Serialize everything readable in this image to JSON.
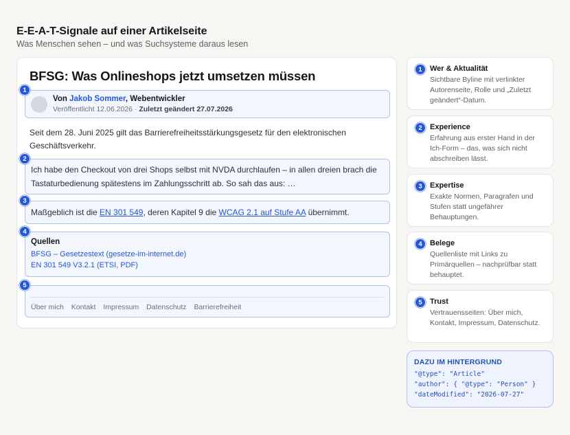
{
  "header": {
    "title": "E-E-A-T-Signale auf einer Artikelseite",
    "subtitle": "Was Menschen sehen – und was Suchsysteme daraus lesen"
  },
  "article": {
    "heading": "BFSG: Was Onlineshops jetzt umsetzen müssen",
    "byline": {
      "marker": "1",
      "prefix": "Von ",
      "author": "Jakob Sommer",
      "role": ", Webentwickler",
      "published": "Veröffentlicht 12.06.2026 · ",
      "updated": "Zuletzt geändert 27.07.2026"
    },
    "intro": "Seit dem 28. Juni 2025 gilt das Barrierefreiheitsstärkungsgesetz für den elektronischen Geschäftsverkehr.",
    "experience": {
      "marker": "2",
      "text": "Ich habe den Checkout von drei Shops selbst mit NVDA durchlaufen – in allen dreien brach die Tastaturbedienung spätestens im Zahlungsschritt ab. So sah das aus: …"
    },
    "expertise": {
      "marker": "3",
      "text_before": "Maßgeblich ist die ",
      "link1": "EN 301 549",
      "text_middle": ", deren Kapitel 9 die ",
      "link2": "WCAG 2.1 auf Stufe AA",
      "text_after": " übernimmt."
    },
    "sources": {
      "marker": "4",
      "title": "Quellen",
      "items": [
        "BFSG – Gesetzestext (gesetze-im-internet.de)",
        "EN 301 549 V3.2.1 (ETSI, PDF)"
      ]
    },
    "trust": {
      "marker": "5",
      "links": [
        "Über mich",
        "Kontakt",
        "Impressum",
        "Datenschutz",
        "Barrierefreiheit"
      ]
    }
  },
  "signals": [
    {
      "number": "1",
      "title": "Wer & Aktualität",
      "description": "Sichtbare Byline mit verlinkter Autorenseite, Rolle und „Zuletzt geändert“-Datum."
    },
    {
      "number": "2",
      "title": "Experience",
      "description": "Erfahrung aus erster Hand in der Ich-Form – das, was sich nicht abschreiben lässt."
    },
    {
      "number": "3",
      "title": "Expertise",
      "description": "Exakte Normen, Paragrafen und Stufen statt ungefährer Behauptungen."
    },
    {
      "number": "4",
      "title": "Belege",
      "description": "Quellenliste mit Links zu Primärquellen – nachprüfbar statt behauptet."
    },
    {
      "number": "5",
      "title": "Trust",
      "description": "Vertrauensseiten: Über mich, Kontakt, Impressum, Datenschutz."
    }
  ],
  "schema": {
    "title": "DAZU IM HINTERGRUND",
    "lines": [
      "\"@type\": \"Article\"",
      "\"author\": { \"@type\": \"Person\" }",
      "\"dateModified\": \"2026-07-27\""
    ]
  },
  "colors": {
    "accent": "#2457d6",
    "highlight_fill": "#f3f6fd",
    "highlight_border": "#aec2ec",
    "background": "#f7f6f3"
  }
}
